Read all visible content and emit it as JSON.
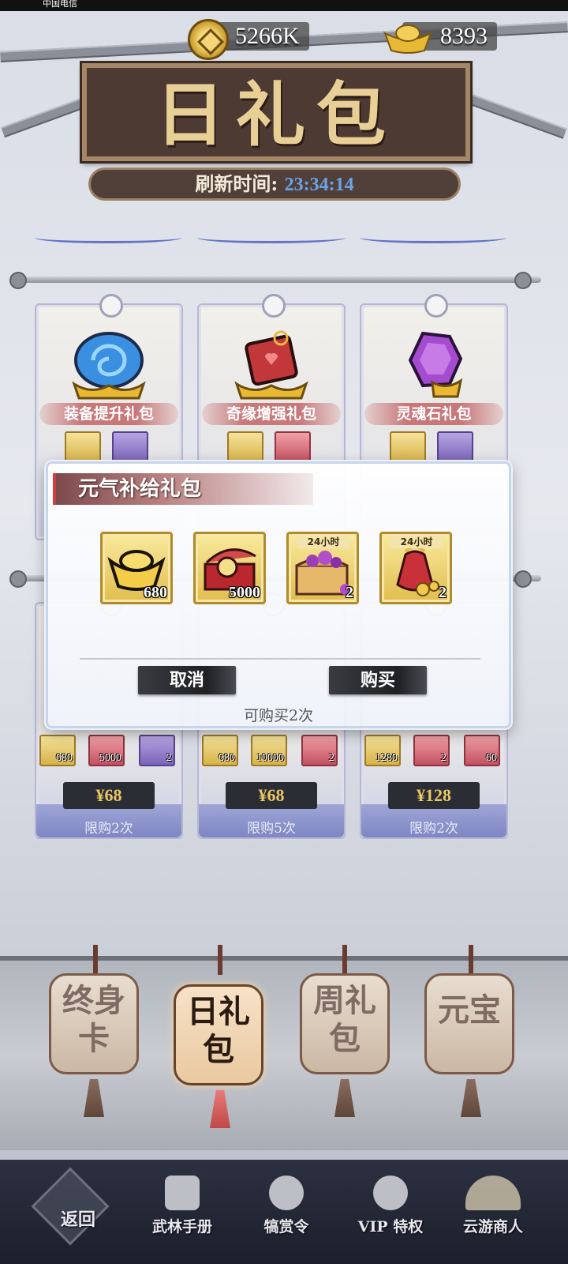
{
  "status_bar": {
    "carrier": "中国电信"
  },
  "currency": {
    "coins": "5266K",
    "ingots": "8393"
  },
  "header": {
    "title": "日礼包",
    "refresh_label": "刷新时间:",
    "refresh_time": "23:34:14"
  },
  "cards_row1": [
    {
      "name": "装备提升礼包"
    },
    {
      "name": "奇缘增强礼包"
    },
    {
      "name": "灵魂石礼包"
    }
  ],
  "cards_row2": [
    {
      "items": [
        "680",
        "5000",
        "2"
      ],
      "price": "¥68",
      "limit": "限购2次"
    },
    {
      "items": [
        "680",
        "10000",
        "2"
      ],
      "price": "¥68",
      "limit": "限购5次"
    },
    {
      "items": [
        "1280",
        "2",
        "60"
      ],
      "price": "¥128",
      "limit": "限购2次"
    }
  ],
  "modal": {
    "title": "元气补给礼包",
    "items": [
      {
        "icon": "gold-ingot-icon",
        "count": "680",
        "tag": ""
      },
      {
        "icon": "jade-box-icon",
        "count": "5000",
        "tag": ""
      },
      {
        "icon": "treasure-chest-icon",
        "count": "2",
        "tag": "24小时"
      },
      {
        "icon": "lucky-bag-icon",
        "count": "2",
        "tag": "24小时"
      }
    ],
    "cancel": "取消",
    "buy": "购买",
    "buy_count": "可购买2次"
  },
  "lanterns": [
    {
      "text": "终身卡",
      "active": false
    },
    {
      "text": "日礼包",
      "active": true
    },
    {
      "text": "周礼包",
      "active": false
    },
    {
      "text": "元宝",
      "active": false
    }
  ],
  "nav": [
    {
      "label": "返回"
    },
    {
      "label": "武林手册"
    },
    {
      "label": "犒赏令"
    },
    {
      "label": "VIP 特权"
    },
    {
      "label": "云游商人"
    }
  ],
  "colors": {
    "accent_gold": "#ecc765",
    "refresh_blue": "#6aa3e8",
    "plaque": "#4c3a33"
  }
}
